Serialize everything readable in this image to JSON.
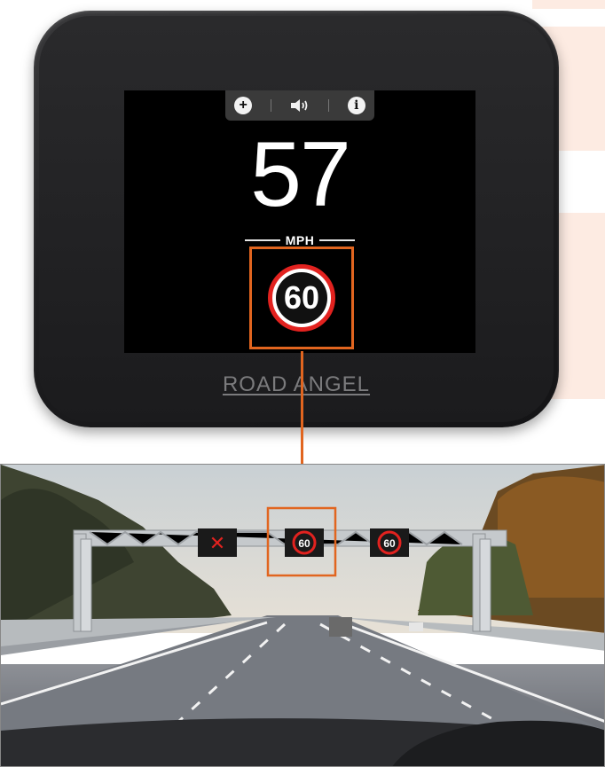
{
  "device": {
    "brand": "ROAD ANGEL",
    "speed": "57",
    "unit": "MPH",
    "speed_limit": "60",
    "toolbar": {
      "add_icon": "plus-icon",
      "volume_icon": "speaker-icon",
      "info_icon": "info-icon"
    }
  },
  "photo": {
    "gantry_signs": [
      "✕",
      "60",
      "60"
    ]
  },
  "colors": {
    "accent": "#e1651f",
    "sign_ring": "#e2221f",
    "device_body": "#1e1e20"
  }
}
